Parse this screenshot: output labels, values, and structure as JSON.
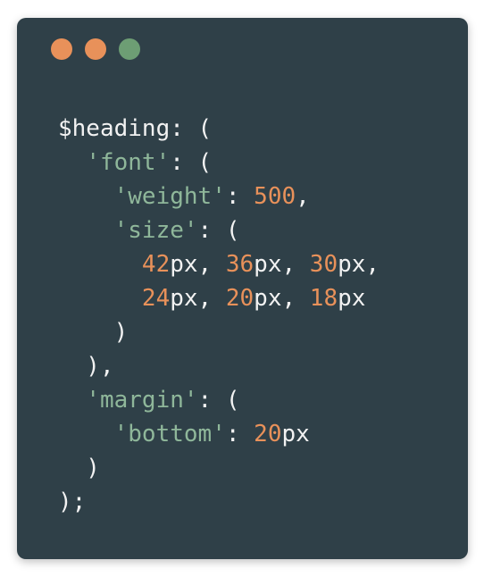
{
  "window": {
    "controls": [
      {
        "name": "close",
        "color": "#e8915a"
      },
      {
        "name": "minimize",
        "color": "#e8915a"
      },
      {
        "name": "zoom",
        "color": "#6d9e74"
      }
    ]
  },
  "theme": {
    "background": "#2f4048",
    "plain": "#f2f2f2",
    "string": "#8fb79a",
    "number": "#e8915a"
  },
  "code_lines": [
    [
      {
        "t": "plain",
        "v": "$heading: ("
      }
    ],
    [
      {
        "t": "plain",
        "v": "  "
      },
      {
        "t": "string",
        "v": "'font'"
      },
      {
        "t": "plain",
        "v": ": ("
      }
    ],
    [
      {
        "t": "plain",
        "v": "    "
      },
      {
        "t": "string",
        "v": "'weight'"
      },
      {
        "t": "plain",
        "v": ": "
      },
      {
        "t": "number",
        "v": "500"
      },
      {
        "t": "plain",
        "v": ","
      }
    ],
    [
      {
        "t": "plain",
        "v": "    "
      },
      {
        "t": "string",
        "v": "'size'"
      },
      {
        "t": "plain",
        "v": ": ("
      }
    ],
    [
      {
        "t": "plain",
        "v": "      "
      },
      {
        "t": "number",
        "v": "42"
      },
      {
        "t": "plain",
        "v": "px, "
      },
      {
        "t": "number",
        "v": "36"
      },
      {
        "t": "plain",
        "v": "px, "
      },
      {
        "t": "number",
        "v": "30"
      },
      {
        "t": "plain",
        "v": "px,"
      }
    ],
    [
      {
        "t": "plain",
        "v": "      "
      },
      {
        "t": "number",
        "v": "24"
      },
      {
        "t": "plain",
        "v": "px, "
      },
      {
        "t": "number",
        "v": "20"
      },
      {
        "t": "plain",
        "v": "px, "
      },
      {
        "t": "number",
        "v": "18"
      },
      {
        "t": "plain",
        "v": "px"
      }
    ],
    [
      {
        "t": "plain",
        "v": "    )"
      }
    ],
    [
      {
        "t": "plain",
        "v": "  ),"
      }
    ],
    [
      {
        "t": "plain",
        "v": "  "
      },
      {
        "t": "string",
        "v": "'margin'"
      },
      {
        "t": "plain",
        "v": ": ("
      }
    ],
    [
      {
        "t": "plain",
        "v": "    "
      },
      {
        "t": "string",
        "v": "'bottom'"
      },
      {
        "t": "plain",
        "v": ": "
      },
      {
        "t": "number",
        "v": "20"
      },
      {
        "t": "plain",
        "v": "px"
      }
    ],
    [
      {
        "t": "plain",
        "v": "  )"
      }
    ],
    [
      {
        "t": "plain",
        "v": ");"
      }
    ]
  ]
}
